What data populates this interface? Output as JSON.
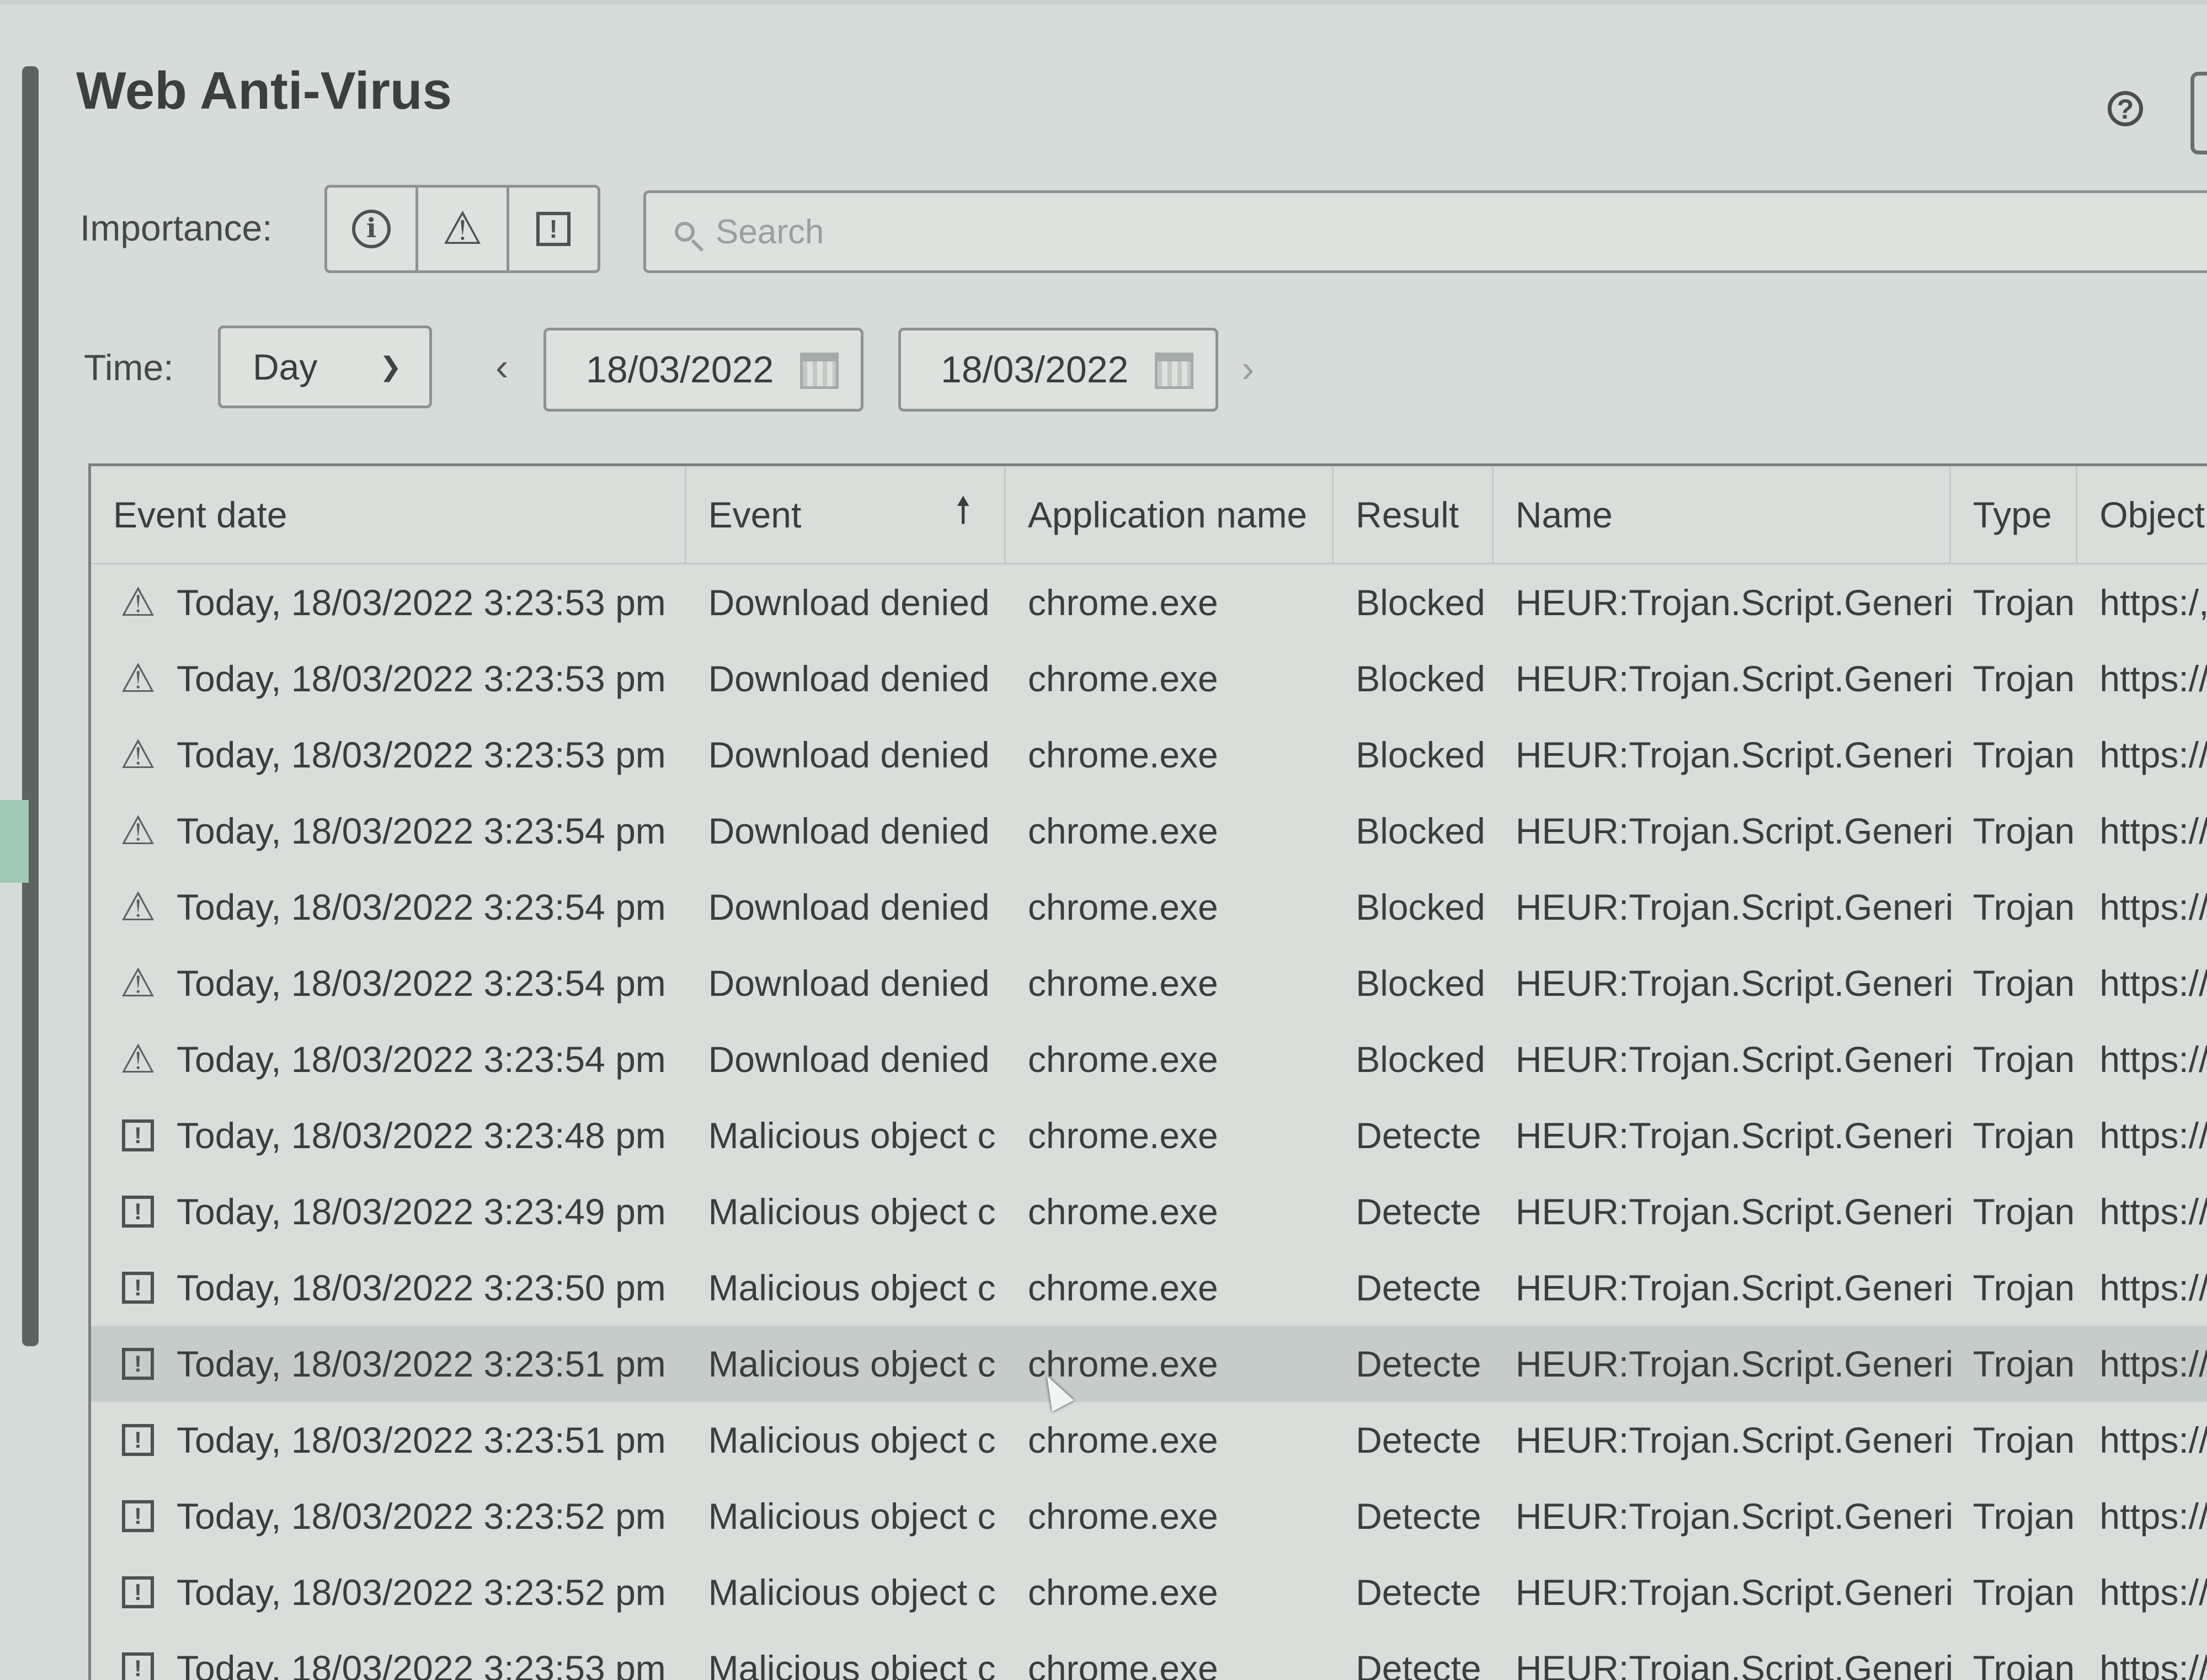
{
  "window": {
    "title": "Web Anti-Virus"
  },
  "filters": {
    "importance_label": "Importance:",
    "importance_buttons": [
      {
        "icon": "info-icon",
        "glyph": "i"
      },
      {
        "icon": "warning-icon",
        "glyph": "⚠"
      },
      {
        "icon": "critical-icon",
        "glyph": "!"
      }
    ],
    "search_placeholder": "Search",
    "time_label": "Time:",
    "time_period": "Day",
    "date_from": "18/03/2022",
    "date_to": "18/03/2022"
  },
  "table": {
    "columns": [
      "Event date",
      "Event",
      "Application name",
      "Result",
      "Name",
      "Type",
      "Object"
    ],
    "sorted_column": "Event",
    "sort_arrow": "🠕",
    "rows": [
      {
        "icon": "warning",
        "date": "Today, 18/03/2022 3:23:53 pm",
        "event": "Download denied",
        "app": "chrome.exe",
        "result": "Blocked",
        "name": "HEUR:Trojan.Script.Generic",
        "type": "Trojan",
        "object": "https:/,"
      },
      {
        "icon": "warning",
        "date": "Today, 18/03/2022 3:23:53 pm",
        "event": "Download denied",
        "app": "chrome.exe",
        "result": "Blocked",
        "name": "HEUR:Trojan.Script.Generic",
        "type": "Trojan",
        "object": "https://"
      },
      {
        "icon": "warning",
        "date": "Today, 18/03/2022 3:23:53 pm",
        "event": "Download denied",
        "app": "chrome.exe",
        "result": "Blocked",
        "name": "HEUR:Trojan.Script.Generic",
        "type": "Trojan",
        "object": "https://"
      },
      {
        "icon": "warning",
        "date": "Today, 18/03/2022 3:23:54 pm",
        "event": "Download denied",
        "app": "chrome.exe",
        "result": "Blocked",
        "name": "HEUR:Trojan.Script.Generic",
        "type": "Trojan",
        "object": "https://"
      },
      {
        "icon": "warning",
        "date": "Today, 18/03/2022 3:23:54 pm",
        "event": "Download denied",
        "app": "chrome.exe",
        "result": "Blocked",
        "name": "HEUR:Trojan.Script.Generic",
        "type": "Trojan",
        "object": "https://l"
      },
      {
        "icon": "warning",
        "date": "Today, 18/03/2022 3:23:54 pm",
        "event": "Download denied",
        "app": "chrome.exe",
        "result": "Blocked",
        "name": "HEUR:Trojan.Script.Generic",
        "type": "Trojan",
        "object": "https://k"
      },
      {
        "icon": "warning",
        "date": "Today, 18/03/2022 3:23:54 pm",
        "event": "Download denied",
        "app": "chrome.exe",
        "result": "Blocked",
        "name": "HEUR:Trojan.Script.Generic",
        "type": "Trojan",
        "object": "https://k"
      },
      {
        "icon": "critical",
        "date": "Today, 18/03/2022 3:23:48 pm",
        "event": "Malicious object c",
        "app": "chrome.exe",
        "result": "Detecte",
        "name": "HEUR:Trojan.Script.Generic",
        "type": "Trojan",
        "object": "https://k"
      },
      {
        "icon": "critical",
        "date": "Today, 18/03/2022 3:23:49 pm",
        "event": "Malicious object c",
        "app": "chrome.exe",
        "result": "Detecte",
        "name": "HEUR:Trojan.Script.Generic",
        "type": "Trojan",
        "object": "https://ku"
      },
      {
        "icon": "critical",
        "date": "Today, 18/03/2022 3:23:50 pm",
        "event": "Malicious object c",
        "app": "chrome.exe",
        "result": "Detecte",
        "name": "HEUR:Trojan.Script.Generic",
        "type": "Trojan",
        "object": "https://ku"
      },
      {
        "icon": "critical",
        "date": "Today, 18/03/2022 3:23:51 pm",
        "event": "Malicious object c",
        "app": "chrome.exe",
        "result": "Detecte",
        "name": "HEUR:Trojan.Script.Generic",
        "type": "Trojan",
        "object": "https://ku"
      },
      {
        "icon": "critical",
        "date": "Today, 18/03/2022 3:23:51 pm",
        "event": "Malicious object c",
        "app": "chrome.exe",
        "result": "Detecte",
        "name": "HEUR:Trojan.Script.Generic",
        "type": "Trojan",
        "object": "https://ku"
      },
      {
        "icon": "critical",
        "date": "Today, 18/03/2022 3:23:52 pm",
        "event": "Malicious object c",
        "app": "chrome.exe",
        "result": "Detecte",
        "name": "HEUR:Trojan.Script.Generic",
        "type": "Trojan",
        "object": "https://ku"
      },
      {
        "icon": "critical",
        "date": "Today, 18/03/2022 3:23:52 pm",
        "event": "Malicious object c",
        "app": "chrome.exe",
        "result": "Detecte",
        "name": "HEUR:Trojan.Script.Generic",
        "type": "Trojan",
        "object": "https://ku"
      },
      {
        "icon": "critical",
        "date": "Today, 18/03/2022 3:23:53 pm",
        "event": "Malicious object c",
        "app": "chrome.exe",
        "result": "Detecte",
        "name": "HEUR:Trojan.Script.Generic",
        "type": "Trojan",
        "object": "https://ku"
      }
    ],
    "highlighted_row": 10
  },
  "colors": {
    "background": "#d6dcd9",
    "highlight_row": "#c6ccc9",
    "border": "#8d9390",
    "text": "#3a3f3d"
  }
}
